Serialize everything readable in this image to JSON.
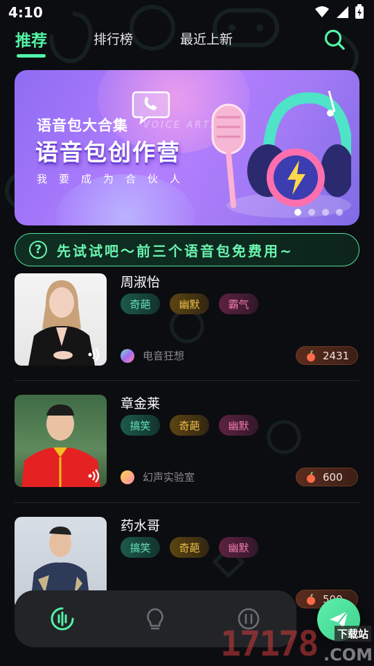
{
  "status": {
    "time": "4:10"
  },
  "nav": {
    "tabs": [
      {
        "label": "推荐",
        "active": true
      },
      {
        "label": "排行榜",
        "active": false
      },
      {
        "label": "最近上新",
        "active": false
      }
    ]
  },
  "banner": {
    "subtitle": "语音包大合集",
    "title": "语音包创作营",
    "english": "VOICE ARTI",
    "slogan": "我要成为合伙人",
    "slide_count": 4,
    "active_slide": 1
  },
  "tip": {
    "text": "先试试吧～前三个语音包免费用~"
  },
  "packs": [
    {
      "name": "周淑怡",
      "tags": [
        "奇葩",
        "幽默",
        "霸气"
      ],
      "author": "电音狂想",
      "count": "2431"
    },
    {
      "name": "章金莱",
      "tags": [
        "搞笑",
        "奇葩",
        "幽默"
      ],
      "author": "幻声实验室",
      "count": "600"
    },
    {
      "name": "药水哥",
      "tags": [
        "搞笑",
        "奇葩",
        "幽默"
      ],
      "author": "",
      "count": "500"
    }
  ],
  "watermark": {
    "big": "17178",
    "sub": "下载站",
    "domain": ".COM"
  },
  "colors": {
    "accent": "#52f3a5",
    "background": "#0c0d10"
  }
}
